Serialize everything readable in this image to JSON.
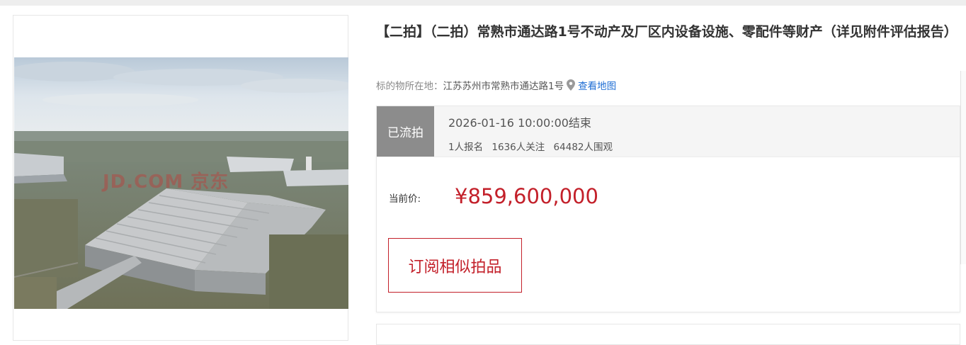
{
  "item": {
    "title": "【二拍】（二拍）常熟市通达路1号不动产及厂区内设备设施、零配件等财产（详见附件评估报告）",
    "location_label": "标的物所在地：",
    "location_value": "江苏苏州市常熟市通达路1号",
    "map_link": "查看地图",
    "pin_icon": "location-pin-icon",
    "image_watermark": "JD.COM 京东"
  },
  "auction": {
    "status": "已流拍",
    "end_time": "2026-01-16 10:00:00结束",
    "stats": {
      "registered": "1人报名",
      "followers": "1636人关注",
      "viewers": "64482人围观"
    },
    "price_label": "当前价:",
    "price_value": "¥859,600,000",
    "subscribe_label": "订阅相似拍品"
  },
  "colors": {
    "accent_red": "#c3202a",
    "status_gray": "#8c8c8c",
    "link_blue": "#1f6ed4"
  }
}
